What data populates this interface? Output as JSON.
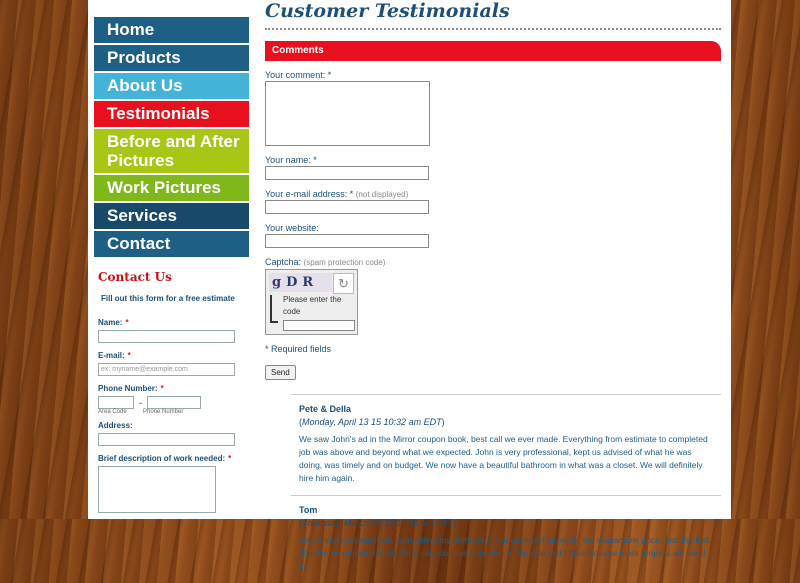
{
  "nav": {
    "items": [
      {
        "label": "Home"
      },
      {
        "label": "Products"
      },
      {
        "label": "About Us"
      },
      {
        "label": "Testimonials"
      },
      {
        "label": "Before and After Pictures"
      },
      {
        "label": "Work Pictures"
      },
      {
        "label": "Services"
      },
      {
        "label": "Contact"
      }
    ]
  },
  "contact_form": {
    "title": "Contact Us",
    "intro": "Fill out this form for a free estimate",
    "name_label": "Name:",
    "email_label": "E-mail:",
    "email_placeholder": "ex: myname@example.com",
    "phone_label": "Phone Number:",
    "phone_dash": "-",
    "area_code_label": "Area Code",
    "phone_number_label": "Phone Number",
    "address_label": "Address:",
    "description_label": "Brief description of work needed:",
    "required_marker": "*"
  },
  "main": {
    "page_title": "Customer Testimonials",
    "comments_header": "Comments",
    "form": {
      "comment_label": "Your comment:",
      "name_label": "Your name:",
      "email_label": "Your e-mail address:",
      "email_note": "(not displayed)",
      "website_label": "Your website:",
      "captcha_label": "Captcha:",
      "captcha_note": "(spam protection code)",
      "captcha_code": "gDR",
      "captcha_prompt": "Please enter the code",
      "required_note": "* Required fields",
      "send_label": "Send",
      "required_marker": "*"
    },
    "comments": [
      {
        "name": "Pete & Della",
        "date": "Monday, April 13 15 10:32 am EDT",
        "body": "We saw John's ad in the Mirror coupon book, best call we ever made. Everything from estimate to completed job was above and beyond what we expected. John is very professional, kept us advised of what he was doing, was timely and on budget. We now have a beautiful bathroom in what was a closet. We will definitely hire him again."
      },
      {
        "name": "Tom",
        "date": "Thursday, March 05 15 11:34 am EST",
        "body": "John did an excellent job remodeling my bathroom. The quality of his work, the reasonable price, and the fast timeline he provided made for a very positive experience. My wife and I have several more projects we need to"
      }
    ]
  }
}
